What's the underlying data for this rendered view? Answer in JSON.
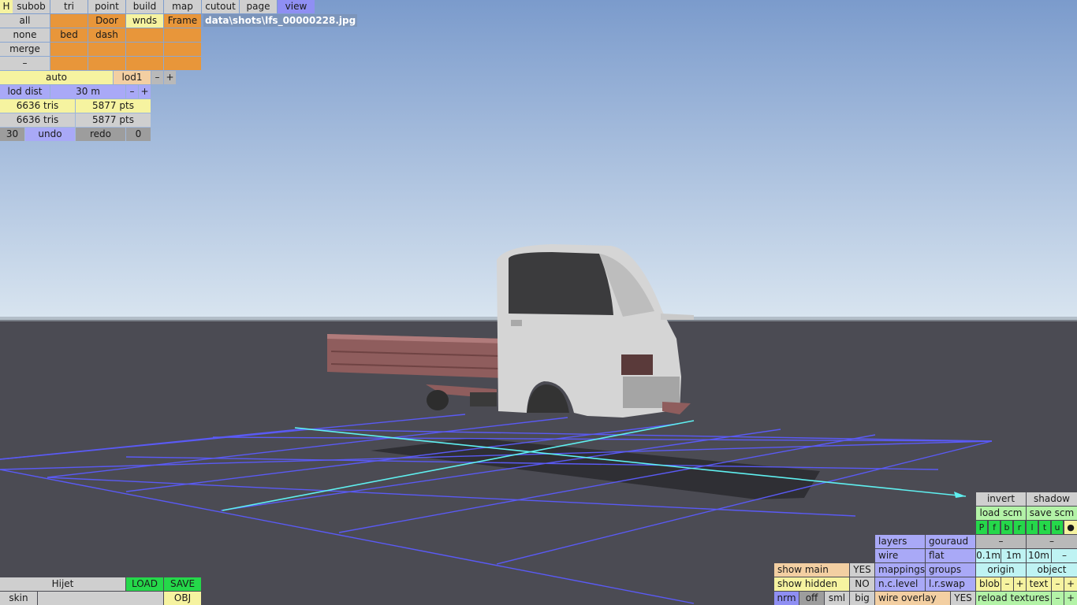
{
  "top_menu": {
    "h": "H",
    "items": [
      "subob",
      "tri",
      "point",
      "build",
      "map",
      "cutout",
      "page",
      "view"
    ],
    "active": "view"
  },
  "groups": {
    "row1": [
      "all",
      "",
      "Door",
      "wnds",
      "Frame"
    ],
    "row2": [
      "none",
      "bed",
      "dash",
      "",
      ""
    ],
    "row3": [
      "merge",
      "",
      "",
      "",
      ""
    ],
    "row4": [
      "–",
      "",
      "",
      "",
      ""
    ]
  },
  "file_path": "data\\shots\\lfs_00000228.jpg",
  "lod": {
    "mode": "auto",
    "level": "lod1",
    "minus": "–",
    "plus": "+"
  },
  "lod_dist": {
    "label": "lod dist",
    "value": "30 m",
    "minus": "–",
    "plus": "+"
  },
  "stats": {
    "tris_a": "6636 tris",
    "pts_a": "5877 pts",
    "tris_b": "6636 tris",
    "pts_b": "5877 pts"
  },
  "undo_bar": {
    "count_left": "30",
    "undo": "undo",
    "redo": "redo",
    "count_right": "0"
  },
  "bottom_left": {
    "name": "Hijet",
    "load": "LOAD",
    "save": "SAVE",
    "skin_label": "skin",
    "skin_value": "",
    "obj": "OBJ"
  },
  "bottom_right": {
    "show_main": "show main",
    "show_main_val": "YES",
    "show_hidden": "show hidden",
    "show_hidden_val": "NO",
    "size_options": [
      "nrm",
      "off",
      "sml",
      "big"
    ],
    "layers": "layers",
    "gouraud": "gouraud",
    "wire": "wire",
    "flat": "flat",
    "mappings": "mappings",
    "groups": "groups",
    "nc_level": "n.c.level",
    "lr_swap": "l.r.swap",
    "wire_overlay": "wire overlay",
    "wire_overlay_val": "YES",
    "invert": "invert",
    "shadow": "shadow",
    "load_scm": "load scm",
    "save_scm": "save scm",
    "flags": [
      "P",
      "f",
      "b",
      "r",
      "l",
      "t",
      "u",
      "●"
    ],
    "dash_a": "–",
    "dash_b": "–",
    "grid": [
      "0.1m",
      "1m",
      "10m",
      "–"
    ],
    "origin": "origin",
    "object": "object",
    "blob": "blob",
    "blob_minus": "–",
    "blob_plus": "+",
    "text": "text",
    "text_minus": "–",
    "text_plus": "+",
    "reload_textures": "reload textures",
    "reload_minus": "–",
    "reload_plus": "+"
  },
  "colors": {
    "sky_top": "#7f9fcf",
    "sky_bottom": "#d8e4ef",
    "ground": "#4b4b53",
    "grid": "#5a5af5",
    "axis": "#5ff0f0",
    "accent_orange": "#e8963a"
  }
}
